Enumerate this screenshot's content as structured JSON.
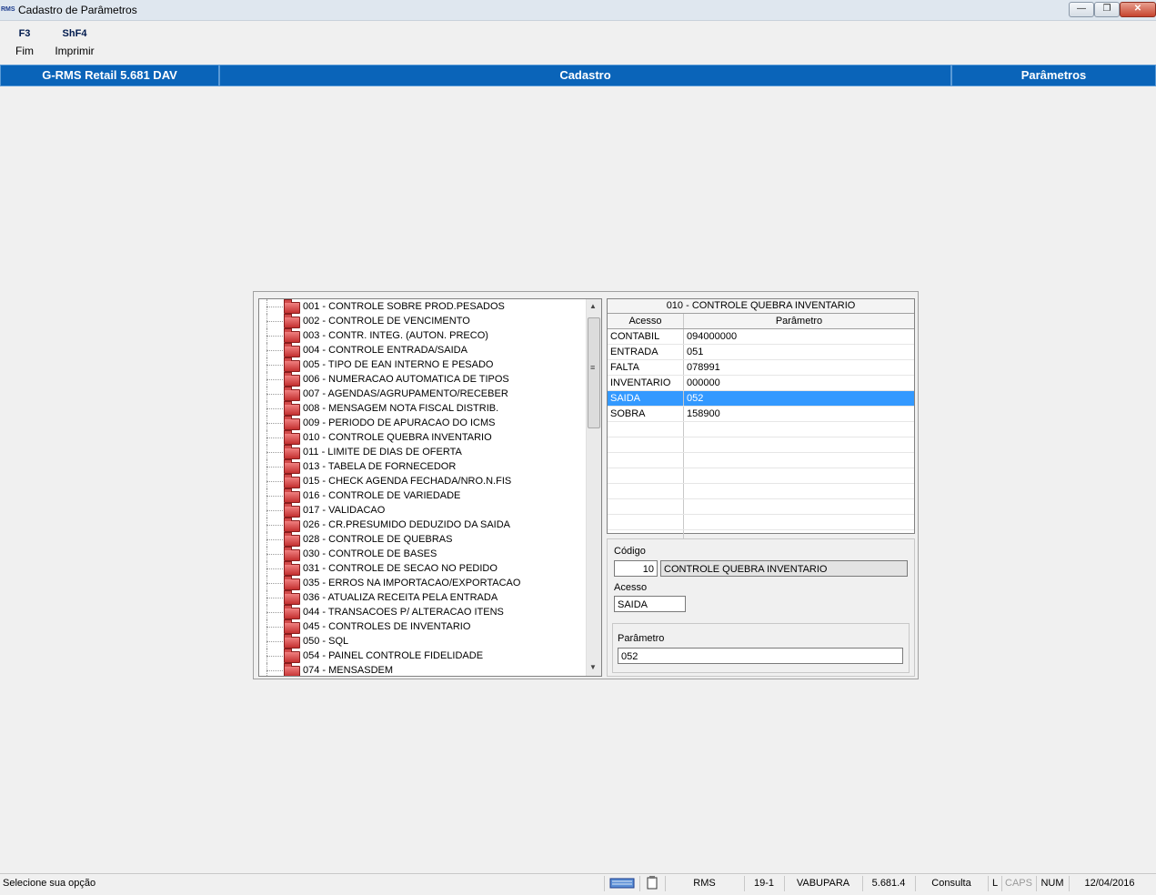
{
  "window": {
    "icon_text": "RMS",
    "title": "Cadastro de Parâmetros",
    "controls": {
      "minimize": "—",
      "restore": "❐",
      "close": "✕"
    }
  },
  "toolbar": [
    {
      "key": "F3",
      "label": "Fim"
    },
    {
      "key": "ShF4",
      "label": "Imprimir"
    }
  ],
  "header": {
    "left": "G-RMS Retail 5.681 DAV",
    "center": "Cadastro",
    "right": "Parâmetros"
  },
  "tree": {
    "items": [
      "001 - CONTROLE SOBRE PROD.PESADOS",
      "002 - CONTROLE DE VENCIMENTO",
      "003 - CONTR. INTEG. (AUTON. PRECO)",
      "004 - CONTROLE ENTRADA/SAIDA",
      "005 - TIPO DE EAN INTERNO E PESADO",
      "006 - NUMERACAO AUTOMATICA DE TIPOS",
      "007 - AGENDAS/AGRUPAMENTO/RECEBER",
      "008 - MENSAGEM NOTA FISCAL DISTRIB.",
      "009 - PERIODO DE APURACAO DO ICMS",
      "010 - CONTROLE QUEBRA INVENTARIO",
      "011 - LIMITE DE DIAS DE OFERTA",
      "013 - TABELA DE FORNECEDOR",
      "015 - CHECK AGENDA FECHADA/NRO.N.FIS",
      "016 - CONTROLE DE VARIEDADE",
      "017 - VALIDACAO",
      "026 - CR.PRESUMIDO DEDUZIDO DA SAIDA",
      "028 - CONTROLE DE QUEBRAS",
      "030 - CONTROLE DE BASES",
      "031 - CONTROLE DE SECAO NO PEDIDO",
      "035 - ERROS NA IMPORTACAO/EXPORTACAO",
      "036 - ATUALIZA RECEITA PELA ENTRADA",
      "044 - TRANSACOES P/ ALTERACAO ITENS",
      "045 - CONTROLES DE INVENTARIO",
      "050 - SQL",
      "054 - PAINEL CONTROLE FIDELIDADE",
      "074 - MENSASDEM"
    ]
  },
  "grid": {
    "title": "010 - CONTROLE QUEBRA INVENTARIO",
    "columns": [
      "Acesso",
      "Parâmetro"
    ],
    "rows": [
      {
        "acesso": "CONTABIL",
        "parametro": "094000000"
      },
      {
        "acesso": "ENTRADA",
        "parametro": "051"
      },
      {
        "acesso": "FALTA",
        "parametro": "078991"
      },
      {
        "acesso": "INVENTARIO",
        "parametro": "000000"
      },
      {
        "acesso": "SAIDA",
        "parametro": "052"
      },
      {
        "acesso": "SOBRA",
        "parametro": "158900"
      }
    ],
    "selected_row": 4,
    "empty_rows": 8
  },
  "form": {
    "codigo_label": "Código",
    "codigo_value": "10",
    "codigo_desc": "CONTROLE QUEBRA INVENTARIO",
    "acesso_label": "Acesso",
    "acesso_value": "SAIDA",
    "parametro_label": "Parâmetro",
    "parametro_value": "052"
  },
  "statusbar": {
    "message": "Selecione sua opção",
    "system": "RMS",
    "code": "19-1",
    "user": "VABUPARA",
    "version": "5.681.4",
    "mode": "Consulta",
    "lock": "L",
    "caps": "CAPS",
    "num": "NUM",
    "date": "12/04/2016"
  },
  "colors": {
    "header_bar": "#0a64b9",
    "selection": "#3399ff",
    "folder_icon": "#c43030"
  }
}
